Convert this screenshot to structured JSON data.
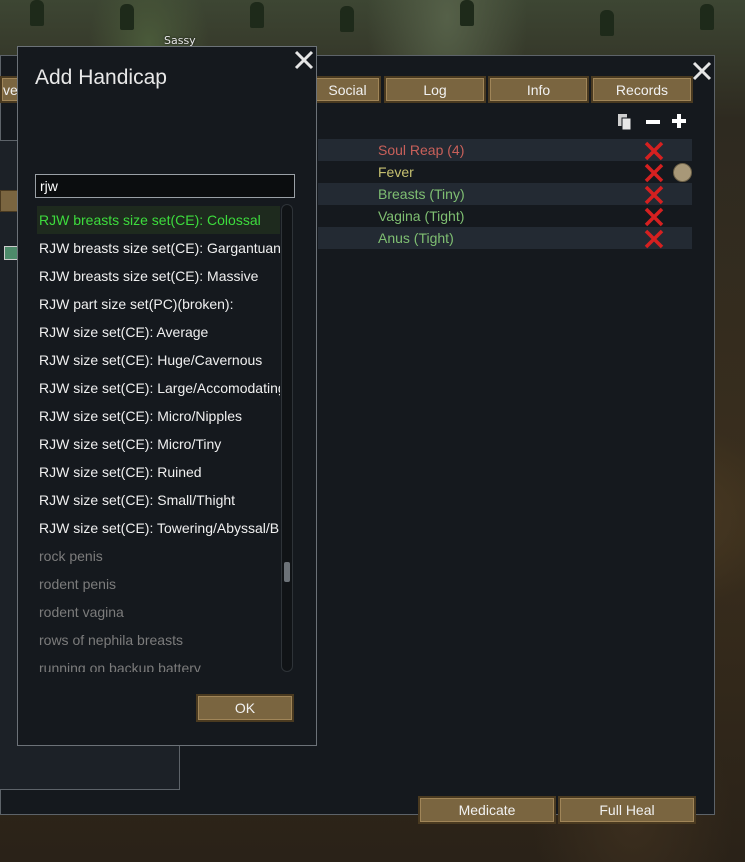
{
  "world": {
    "pawn_label": "Sassy"
  },
  "health_window": {
    "tabs": [
      {
        "label": "ver"
      },
      {
        "label": "Social"
      },
      {
        "label": "Log"
      },
      {
        "label": "Info"
      },
      {
        "label": "Records"
      }
    ],
    "toolbar_icons": [
      "copy-icon",
      "minus-icon",
      "plus-icon"
    ],
    "hediffs": [
      {
        "label": "Soul Reap (4)",
        "color": "#c8605a"
      },
      {
        "label": "Fever",
        "color": "#c6c070"
      },
      {
        "label": "Breasts (Tiny)",
        "color": "#7fbf72"
      },
      {
        "label": "Vagina (Tight)",
        "color": "#7fbf72"
      },
      {
        "label": "Anus (Tight)",
        "color": "#7fbf72"
      }
    ],
    "buttons": {
      "medicate": "Medicate",
      "full_heal": "Full Heal"
    }
  },
  "dialog": {
    "title": "Add Handicap",
    "search": {
      "value": "rjw"
    },
    "options": [
      {
        "label": "RJW breasts size set(CE): Colossal",
        "state": "highlighted",
        "color": "#3ddc3d"
      },
      {
        "label": "RJW breasts size set(CE): Gargantuan",
        "color": "#f0f0f0"
      },
      {
        "label": "RJW breasts size set(CE): Massive",
        "color": "#f0f0f0"
      },
      {
        "label": "RJW part size set(PC)(broken):",
        "color": "#f0f0f0"
      },
      {
        "label": "RJW size set(CE): Average",
        "color": "#f0f0f0"
      },
      {
        "label": "RJW size set(CE): Huge/Cavernous",
        "color": "#f0f0f0"
      },
      {
        "label": "RJW size set(CE): Large/Accomodating",
        "color": "#f0f0f0"
      },
      {
        "label": "RJW size set(CE): Micro/Nipples",
        "color": "#f0f0f0"
      },
      {
        "label": "RJW size set(CE): Micro/Tiny",
        "color": "#f0f0f0"
      },
      {
        "label": "RJW size set(CE): Ruined",
        "color": "#f0f0f0"
      },
      {
        "label": "RJW size set(CE): Small/Thight",
        "color": "#f0f0f0"
      },
      {
        "label": "RJW size set(CE): Towering/Abyssal/B",
        "color": "#f0f0f0"
      },
      {
        "label": "rock penis",
        "color": "#7c7c7c"
      },
      {
        "label": "rodent penis",
        "color": "#7c7c7c"
      },
      {
        "label": "rodent vagina",
        "color": "#7c7c7c"
      },
      {
        "label": "rows of nephila breasts",
        "color": "#7c7c7c"
      },
      {
        "label": "running on backup battery",
        "color": "#7c7c7c"
      }
    ],
    "scroll_position": 0.8,
    "ok_label": "OK"
  }
}
